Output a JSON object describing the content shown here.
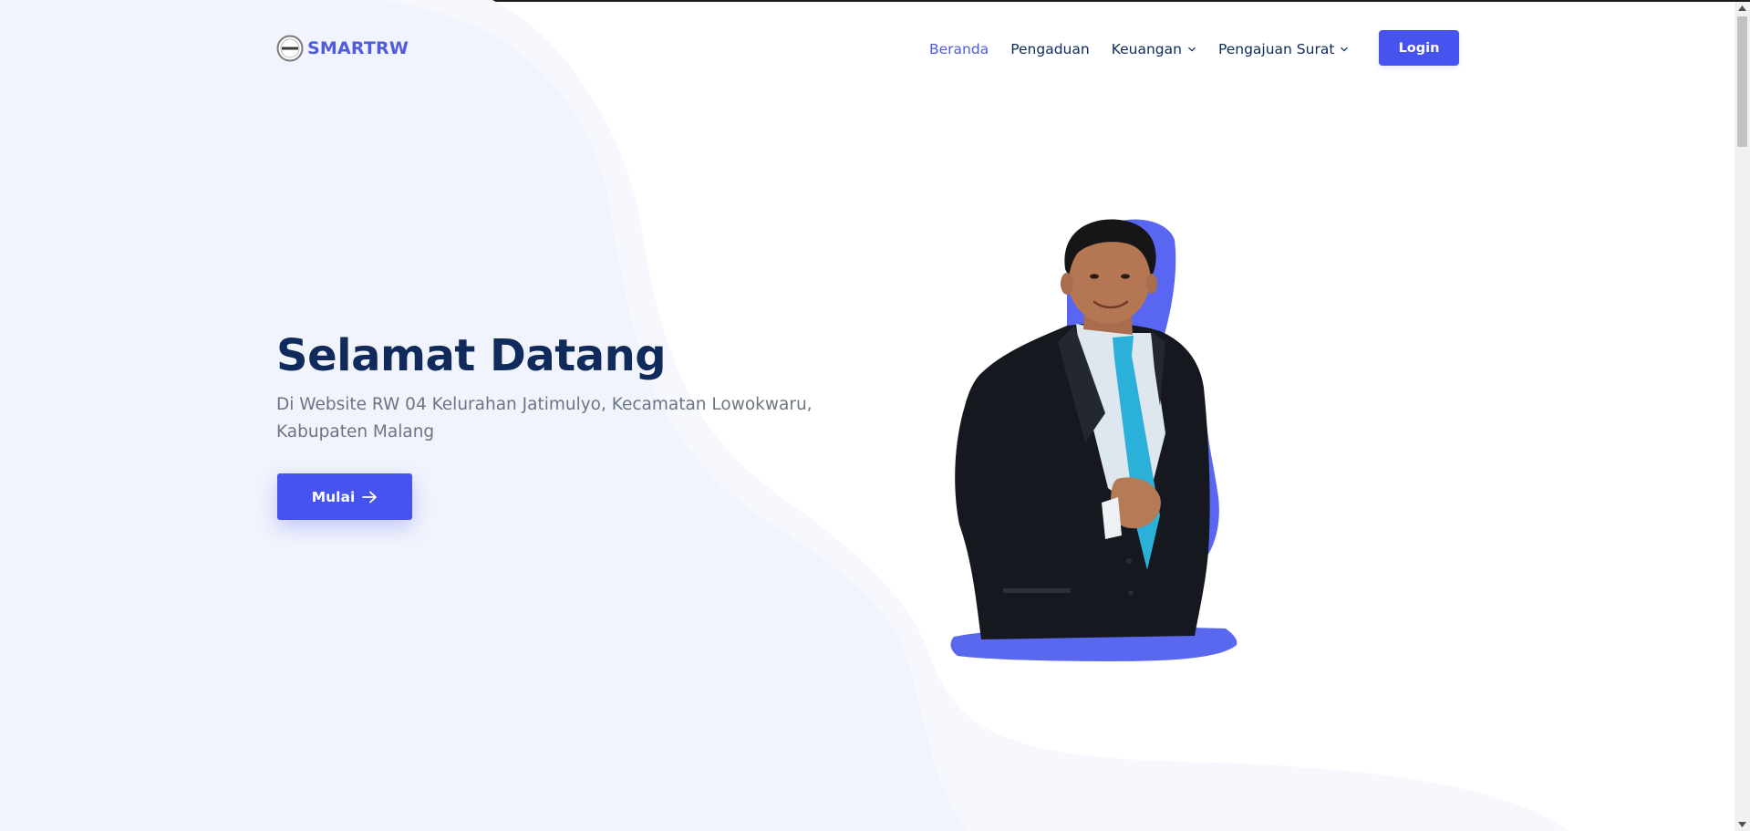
{
  "brand": {
    "name": "SMARTRW",
    "logo_icon": "community-seal-logo",
    "color": "#4f5cdf"
  },
  "nav": {
    "items": [
      {
        "label": "Beranda",
        "active": true
      },
      {
        "label": "Pengaduan",
        "active": false
      },
      {
        "label": "Keuangan",
        "active": false,
        "dropdown": true
      },
      {
        "label": "Pengajuan Surat",
        "active": false,
        "dropdown": true
      }
    ],
    "login_label": "Login"
  },
  "hero": {
    "title": "Selamat Datang",
    "subtitle": "Di Website RW 04 Kelurahan Jatimulyo, Kecamatan Lowokwaru, Kabupaten Malang",
    "cta_label": "Mulai",
    "cta_icon": "arrow-right-icon",
    "image": "portrait of RW leader in black suit with blue tie on blue brush-stroke backdrop"
  },
  "colors": {
    "primary": "#4753ef",
    "accent_blue": "#5a68f0",
    "heading": "#102a5c",
    "body_text": "#6c7582",
    "nav_text": "#0d2b5a",
    "nav_active": "#4c5ce2",
    "bg_wave_light": "#f1f4fc",
    "bg_wave_lighter": "#f7f8fd"
  }
}
